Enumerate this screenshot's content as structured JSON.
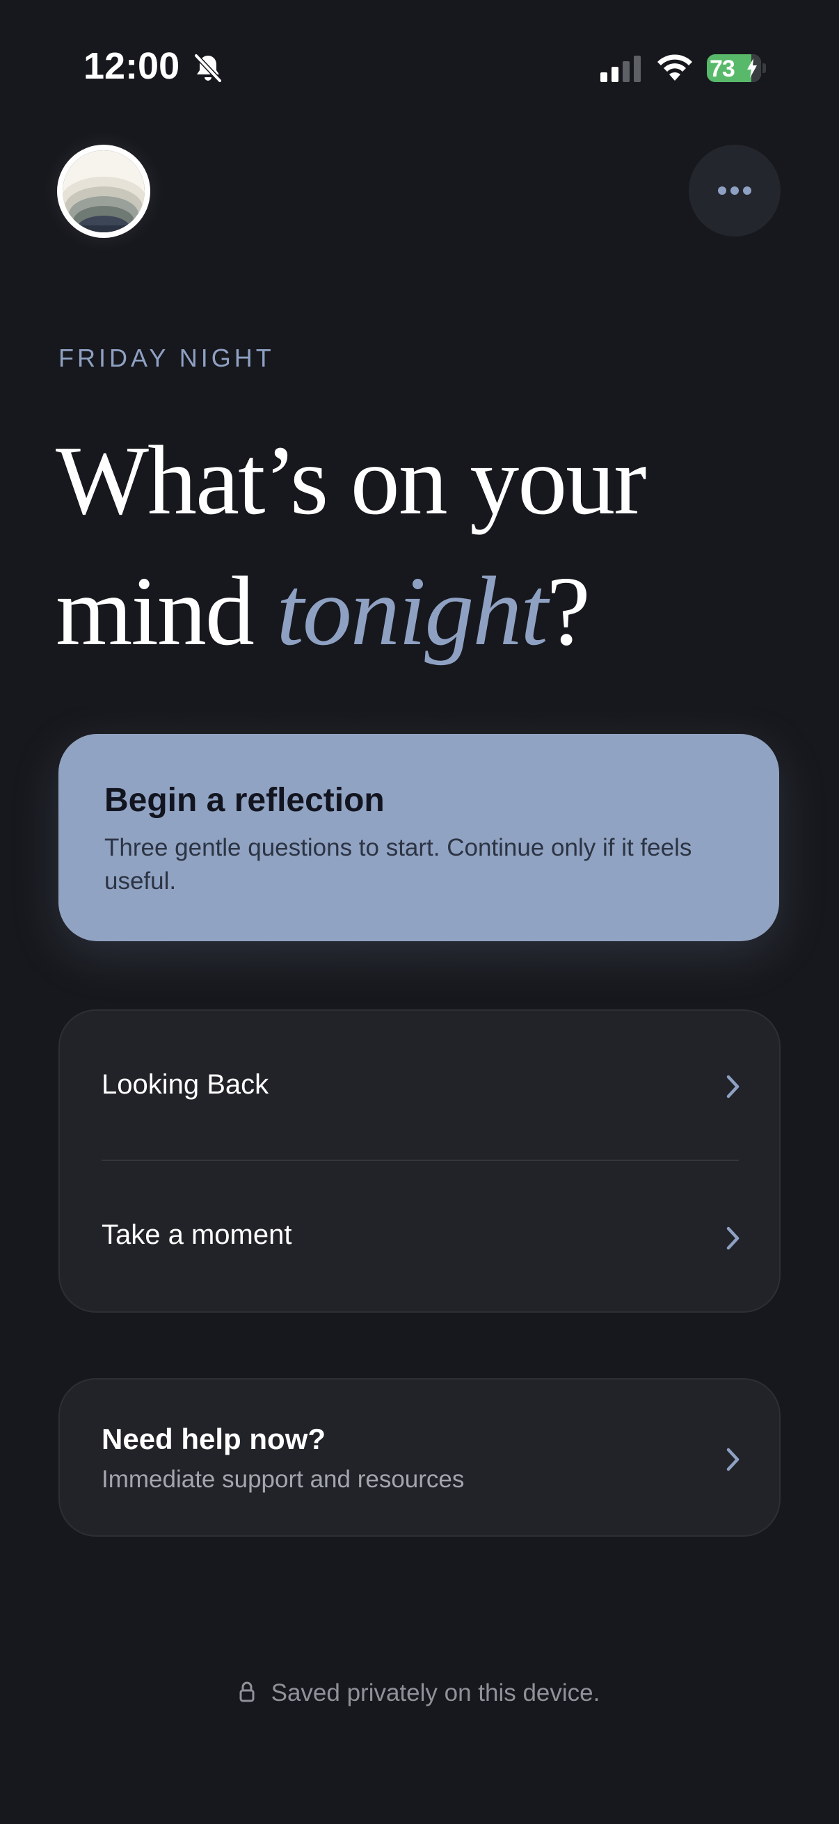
{
  "status_bar": {
    "time": "12:00",
    "battery_level": "73",
    "icons": [
      "bell-slash-icon",
      "cellular-signal-icon",
      "wifi-icon",
      "battery-charging-icon"
    ]
  },
  "header": {
    "more_icon": "ellipsis-icon",
    "avatar_icon": "sunset-avatar"
  },
  "greeting": {
    "eyebrow": "FRIDAY NIGHT",
    "headline_part1": "What’s on your mind ",
    "headline_accent": "tonight",
    "headline_part2": "?"
  },
  "primary_card": {
    "title": "Begin a reflection",
    "description": "Three gentle questions to start. Continue only if it feels useful."
  },
  "menu": {
    "items": [
      {
        "label": "Looking Back",
        "icon": "chevron-right-icon"
      },
      {
        "label": "Take a moment",
        "icon": "chevron-right-icon"
      }
    ]
  },
  "help": {
    "title": "Need help now?",
    "subtitle": "Immediate support and resources",
    "icon": "chevron-right-icon"
  },
  "footer": {
    "text": "Saved privately on this device.",
    "icon": "lock-icon"
  },
  "colors": {
    "background": "#17181d",
    "accent": "#8fa1c3",
    "primary_card": "#91a3c2",
    "card": "#222329",
    "battery": "#59b96a"
  }
}
